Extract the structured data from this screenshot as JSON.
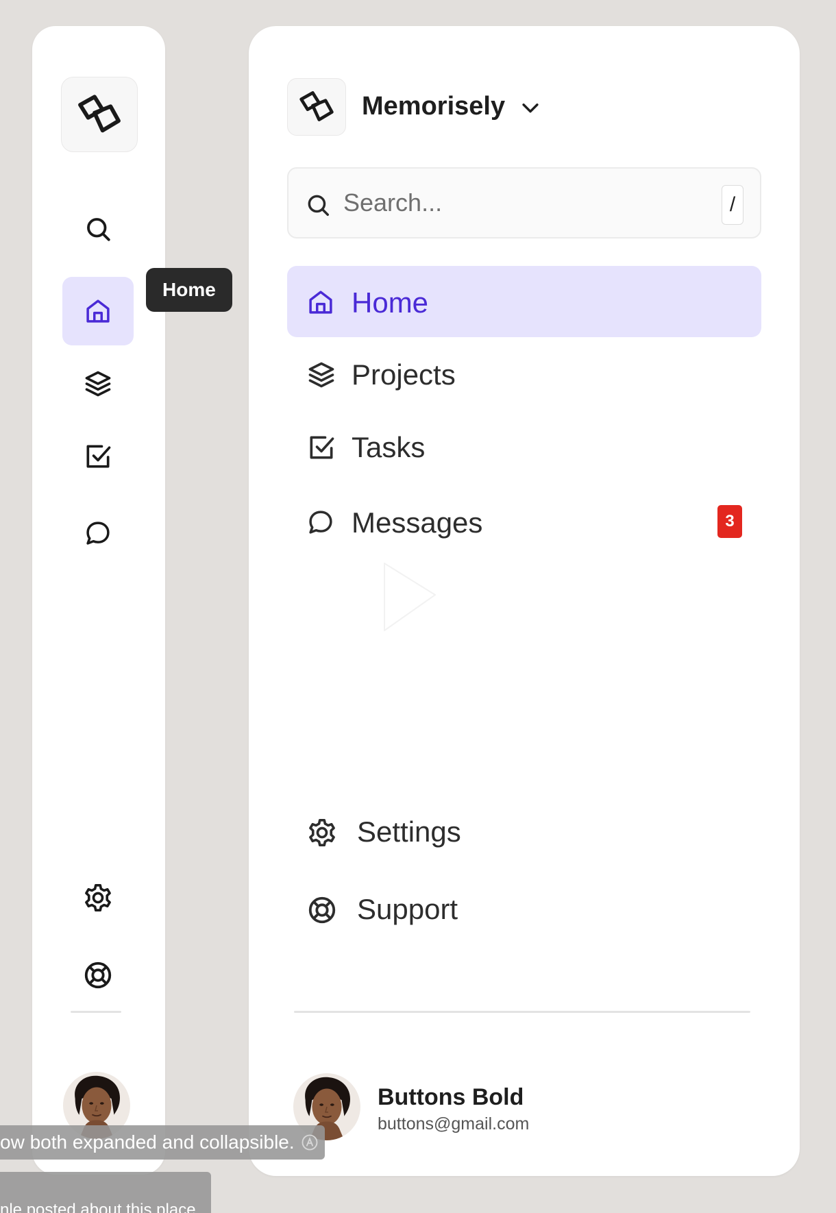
{
  "rail": {
    "tooltip": "Home",
    "items": [
      {
        "icon": "search-icon"
      },
      {
        "icon": "home-icon",
        "active": true
      },
      {
        "icon": "layers-icon"
      },
      {
        "icon": "check-square-icon"
      },
      {
        "icon": "message-icon"
      },
      {
        "icon": "gear-icon"
      },
      {
        "icon": "lifebuoy-icon"
      }
    ]
  },
  "brand": {
    "name": "Memorisely",
    "logo_icon": "cubes-logo-icon",
    "menu_icon": "chevron-down-icon"
  },
  "search": {
    "placeholder": "Search...",
    "value": "",
    "shortcut": "/"
  },
  "nav": {
    "items": [
      {
        "label": "Home",
        "icon": "home-icon",
        "active": true
      },
      {
        "label": "Projects",
        "icon": "layers-icon"
      },
      {
        "label": "Tasks",
        "icon": "check-square-icon"
      },
      {
        "label": "Messages",
        "icon": "message-icon",
        "badge": "3"
      }
    ],
    "footer_items": [
      {
        "label": "Settings",
        "icon": "gear-icon"
      },
      {
        "label": "Support",
        "icon": "lifebuoy-icon"
      }
    ]
  },
  "user": {
    "name": "Buttons Bold",
    "email": "buttons@gmail.com"
  },
  "captions": {
    "line1": "ow both expanded and collapsible.",
    "line2": "nle posted about this place"
  },
  "colors": {
    "background": "#e2dfdc",
    "active_bg": "#e6e3fd",
    "active_fg": "#4a2ad6",
    "badge": "#e3271f",
    "tooltip_bg": "#2a2a2a"
  }
}
